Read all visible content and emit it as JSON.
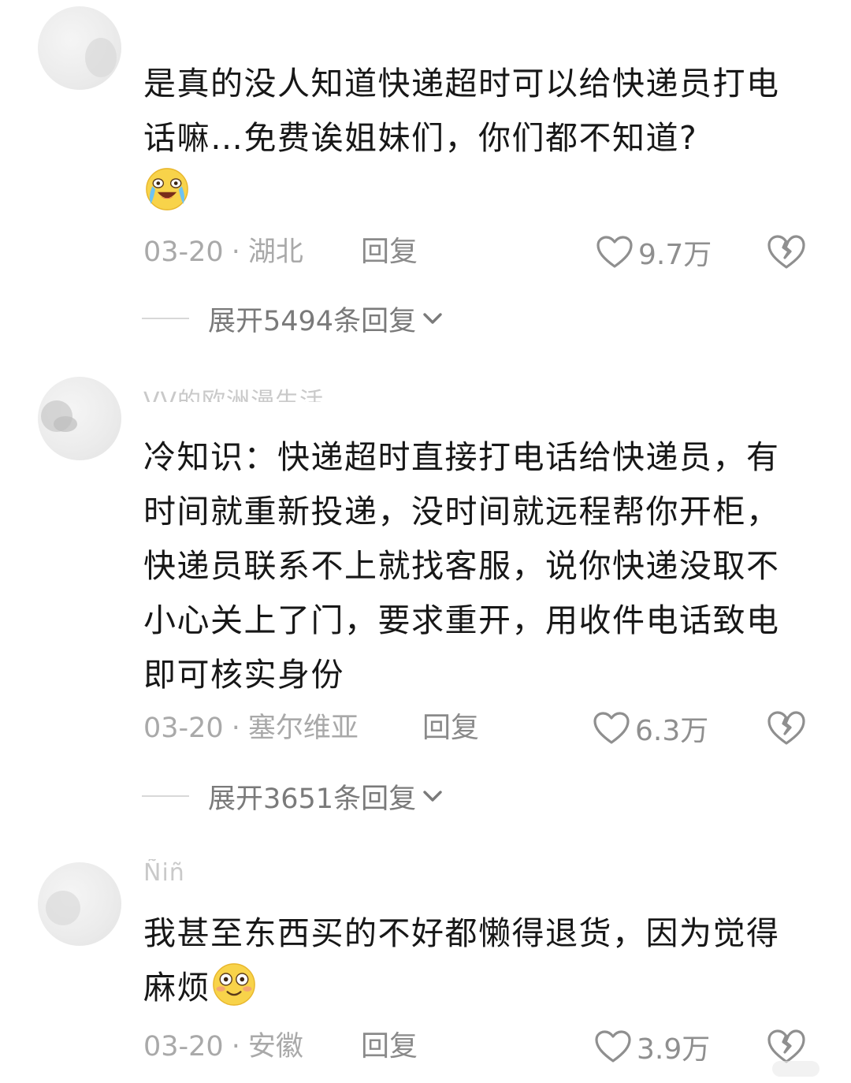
{
  "comments": [
    {
      "username": "",
      "text": "是真的没人知道快递超时可以给快递员打电话嘛…免费诶姐妹们，你们都不知道?",
      "emoji": "crying-laughing-emoji",
      "date": "03-20",
      "separator": "·",
      "location": "湖北",
      "reply_label": "回复",
      "likes": "9.7万",
      "expand_label": "展开5494条回复"
    },
    {
      "username": "VV的欧洲漫生活",
      "text": "冷知识：快递超时直接打电话给快递员，有时间就重新投递，没时间就远程帮你开柜，快递员联系不上就找客服，说你快递没取不小心关上了门，要求重开，用收件电话致电即可核实身份",
      "date": "03-20",
      "separator": "·",
      "location": "塞尔维亚",
      "reply_label": "回复",
      "likes": "6.3万",
      "expand_label": "展开3651条回复"
    },
    {
      "username": "Ñiñ",
      "text": "我甚至东西买的不好都懒得退货，因为觉得麻烦",
      "emoji": "flushed-smile-emoji",
      "date": "03-20",
      "separator": "·",
      "location": "安徽",
      "reply_label": "回复",
      "likes": "3.9万"
    }
  ],
  "icons": {
    "like": "heart-outline-icon",
    "dislike": "broken-heart-icon",
    "expand": "chevron-down-icon"
  },
  "colors": {
    "text": "#171717",
    "meta": "#a9a9a9",
    "action": "#8a8a8a"
  }
}
